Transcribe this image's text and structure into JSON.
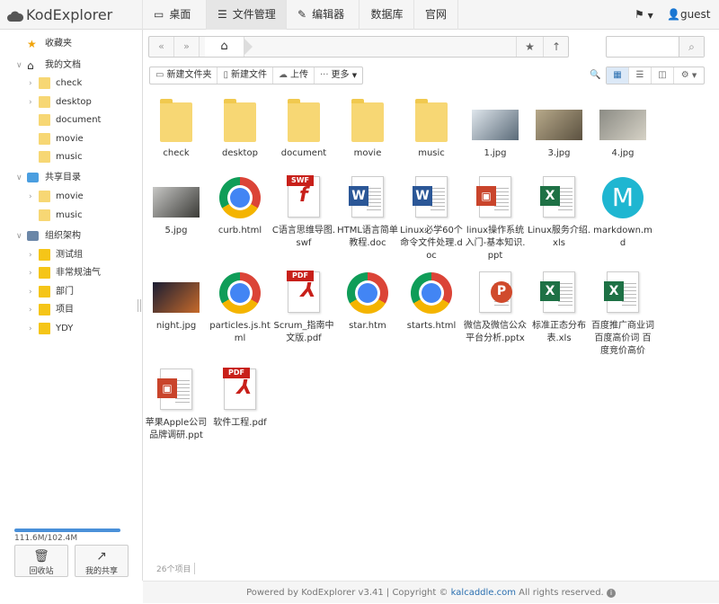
{
  "app": {
    "title": "KodExplorer"
  },
  "nav": [
    {
      "label": "桌面"
    },
    {
      "label": "文件管理"
    },
    {
      "label": "编辑器"
    },
    {
      "label": "数据库"
    },
    {
      "label": "官网"
    }
  ],
  "user": {
    "name": "guest"
  },
  "sidebar": {
    "favorites": "收藏夹",
    "my_docs": "我的文档",
    "my_docs_items": [
      "check",
      "desktop",
      "document",
      "movie",
      "music"
    ],
    "shared": "共享目录",
    "shared_items": [
      "movie",
      "music"
    ],
    "org": "组织架构",
    "org_items": [
      "测试组",
      "非常规油气",
      "部门",
      "项目",
      "YDY"
    ]
  },
  "quota": {
    "text": "111.6M/102.4M",
    "fill_fraction": 1.0
  },
  "bottom_buttons": {
    "recycle": "回收站",
    "share": "我的共享"
  },
  "toolbar": {
    "new_folder": "新建文件夹",
    "new_file": "新建文件",
    "upload": "上传",
    "more": "更多"
  },
  "files": [
    {
      "name": "check",
      "kind": "folder"
    },
    {
      "name": "desktop",
      "kind": "folder"
    },
    {
      "name": "document",
      "kind": "folder"
    },
    {
      "name": "movie",
      "kind": "folder"
    },
    {
      "name": "music",
      "kind": "folder"
    },
    {
      "name": "1.jpg",
      "kind": "image",
      "colors": [
        "#dfe6ec",
        "#5a6a78"
      ]
    },
    {
      "name": "3.jpg",
      "kind": "image",
      "colors": [
        "#b7a98a",
        "#5b5140"
      ]
    },
    {
      "name": "4.jpg",
      "kind": "image",
      "colors": [
        "#8b8b84",
        "#d6d2c6"
      ]
    },
    {
      "name": "5.jpg",
      "kind": "image",
      "colors": [
        "#c7c7c5",
        "#3a3a36"
      ]
    },
    {
      "name": "curb.html",
      "kind": "chrome"
    },
    {
      "name": "C语言思维导图.swf",
      "kind": "swf"
    },
    {
      "name": "HTML语言简单教程.doc",
      "kind": "doc"
    },
    {
      "name": "Linux必学60个命令文件处理.doc",
      "kind": "doc"
    },
    {
      "name": "linux操作系统入门-基本知识.ppt",
      "kind": "ppt"
    },
    {
      "name": "Linux服务介绍.xls",
      "kind": "xls"
    },
    {
      "name": "markdown.md",
      "kind": "md"
    },
    {
      "name": "night.jpg",
      "kind": "image",
      "colors": [
        "#1a1d33",
        "#c76a2a"
      ]
    },
    {
      "name": "particles.js.html",
      "kind": "chrome"
    },
    {
      "name": "Scrum_指南中文版.pdf",
      "kind": "pdf"
    },
    {
      "name": "star.htm",
      "kind": "chrome"
    },
    {
      "name": "starts.html",
      "kind": "chrome"
    },
    {
      "name": "微信及微信公众平台分析.pptx",
      "kind": "pptx"
    },
    {
      "name": "标准正态分布表.xls",
      "kind": "xls"
    },
    {
      "name": "百度推广商业词 百度高价词 百度竞价高价",
      "kind": "xls"
    },
    {
      "name": "苹果Apple公司品牌调研.ppt",
      "kind": "ppt"
    },
    {
      "name": "软件工程.pdf",
      "kind": "pdf"
    }
  ],
  "status": {
    "count": "26个项目"
  },
  "footer": {
    "text": "Powered by KodExplorer v3.41 | Copyright © ",
    "link": "kalcaddle.com",
    "suffix": " All rights reserved."
  }
}
